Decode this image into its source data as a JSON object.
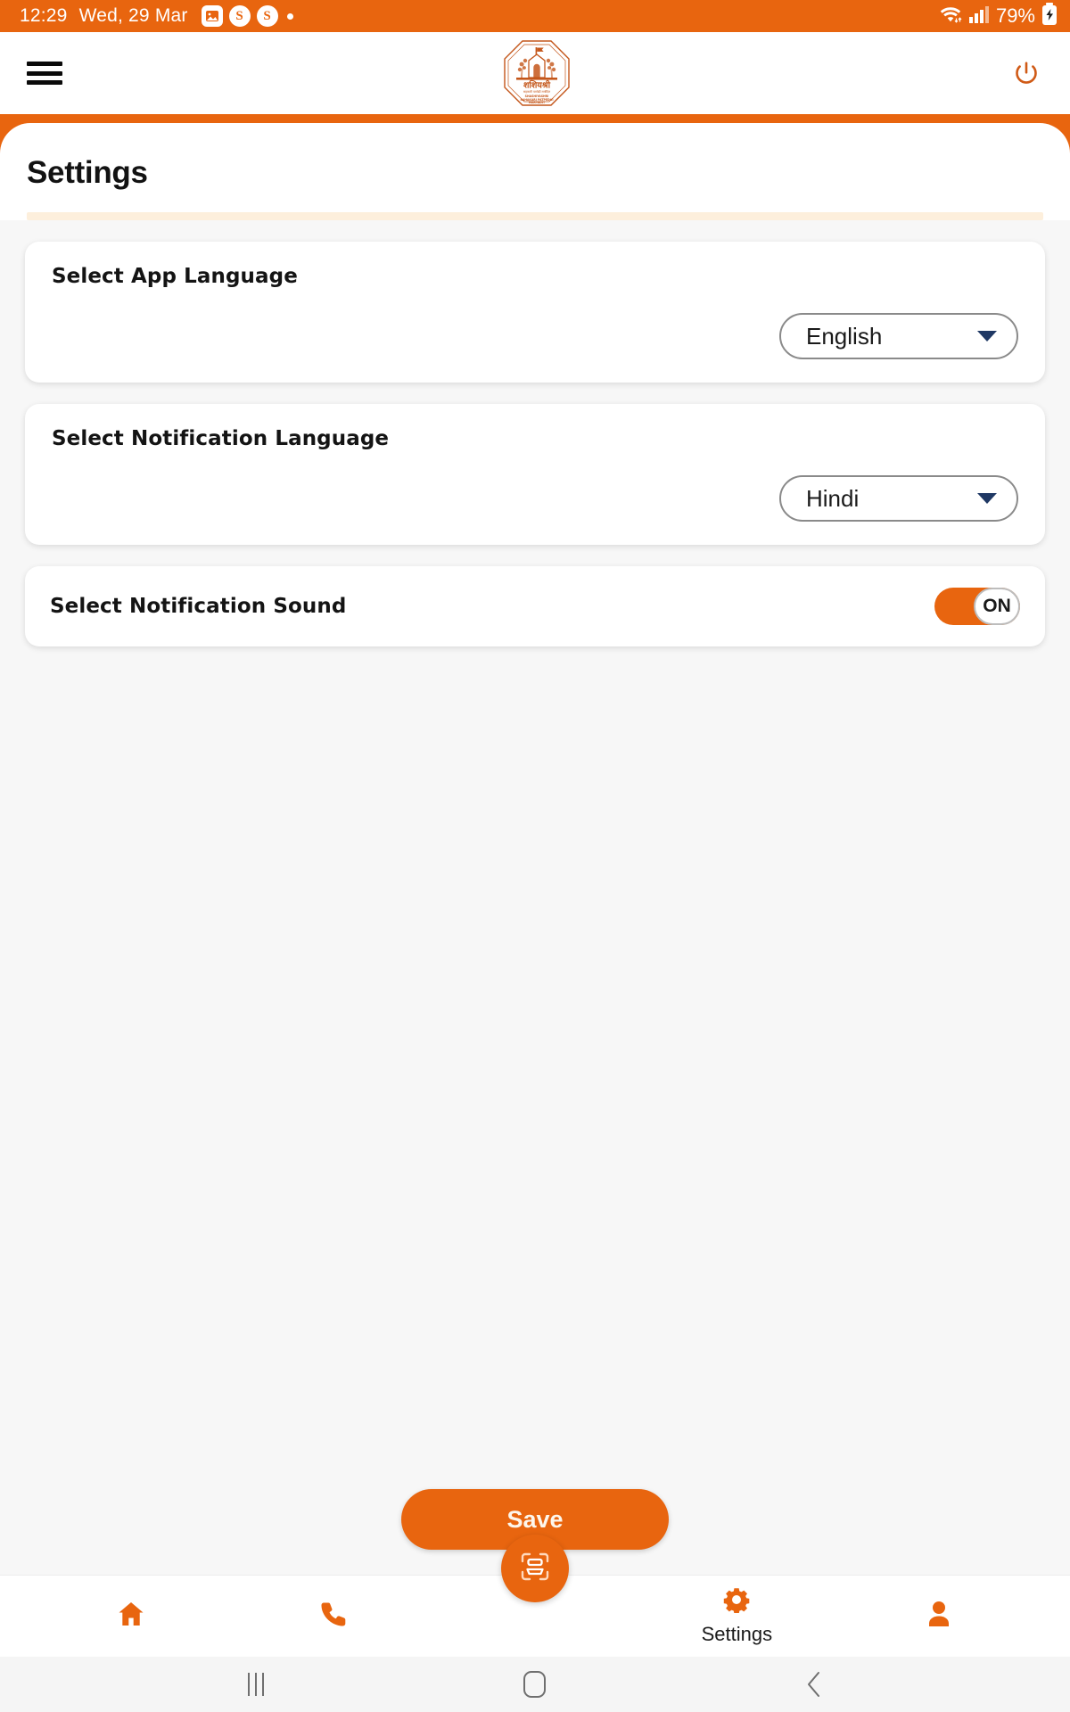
{
  "status_bar": {
    "time": "12:29",
    "date": "Wed, 29 Mar",
    "icons": [
      "image-icon",
      "skype-badge-icon",
      "skype-badge-icon",
      "notification-dot"
    ],
    "skype_glyph": "S",
    "battery_percent": "79%",
    "wifi_icon": "wifi-icon",
    "signal_icon": "cellular-signal-icon",
    "battery_icon": "battery-charging-icon",
    "background_color": "#E8650F",
    "text_color": "#FFFFFF"
  },
  "app_header": {
    "menu_icon": "hamburger-menu-icon",
    "logo_name": "shashiyashri-sahakari-patpedhi-logo",
    "logo_line1": "शशियश्री",
    "logo_line2": "सहकारी पतपेढी मर्यादित",
    "logo_sub1": "SHASHIYASHRI",
    "logo_sub2": "SAHAKARI PATPEDHI",
    "logo_sub3": "MARYADIT",
    "power_icon": "power-logout-icon"
  },
  "page": {
    "title": "Settings",
    "accent_color": "#E8650F",
    "divider_color": "#FDEFDC"
  },
  "settings": {
    "cards": [
      {
        "label": "Select App Language",
        "control": "dropdown",
        "value": "English",
        "name": "app-language-dropdown"
      },
      {
        "label": "Select Notification Language",
        "control": "dropdown",
        "value": "Hindi",
        "name": "notification-language-dropdown"
      },
      {
        "label": "Select Notification Sound",
        "control": "toggle",
        "value": "ON",
        "name": "notification-sound-toggle"
      }
    ]
  },
  "actions": {
    "save_label": "Save"
  },
  "bottom_nav": {
    "items": [
      {
        "icon": "home-icon",
        "label": ""
      },
      {
        "icon": "phone-icon",
        "label": ""
      },
      {
        "icon": "scan-icon",
        "label": ""
      },
      {
        "icon": "gear-icon",
        "label": "Settings"
      },
      {
        "icon": "profile-person-icon",
        "label": ""
      }
    ],
    "active": "Settings",
    "fab_icon": "scan-document-icon",
    "fab_color": "#E8650F"
  },
  "system_nav": {
    "recents": "recents-icon",
    "home": "home-square-icon",
    "back": "back-chevron-icon"
  }
}
